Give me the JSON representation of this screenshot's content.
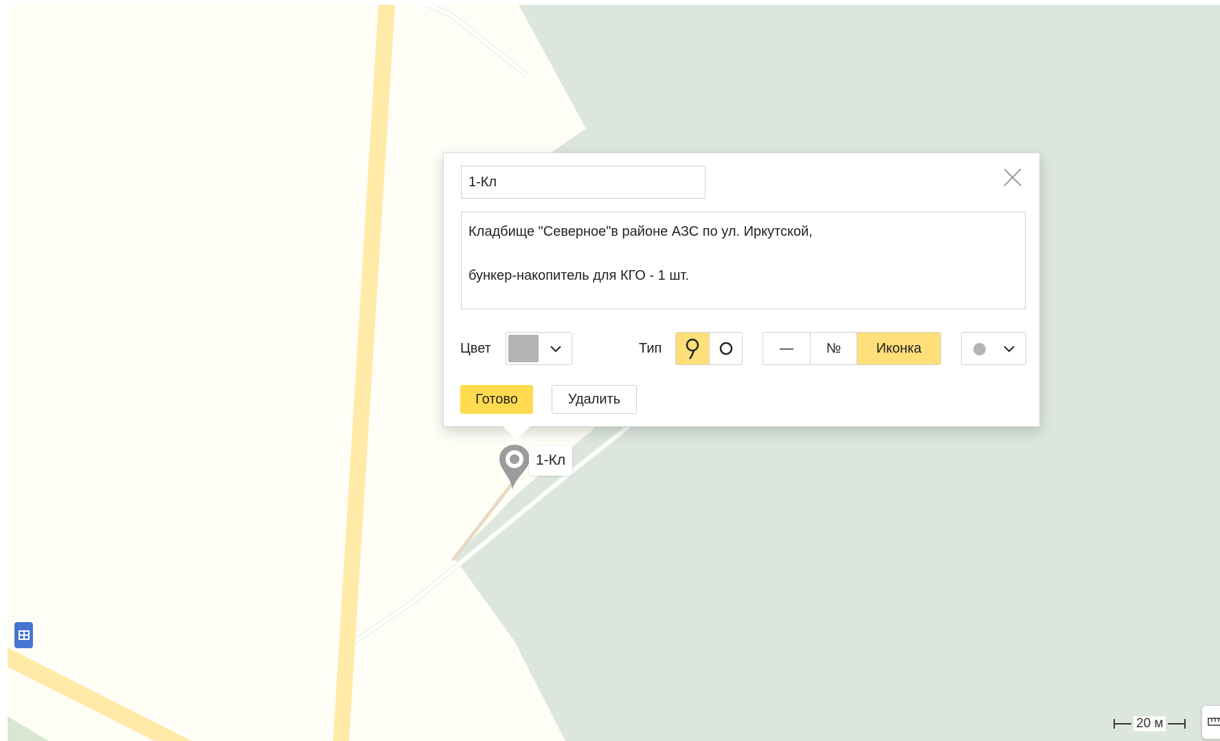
{
  "balloon": {
    "name_value": "1-Кл",
    "description_value": "Кладбище \"Северное\"в районе АЗС по ул. Иркутской,\n\nбункер-накопитель для КГО - 1 шт.",
    "color_label": "Цвет",
    "selected_color": "#b3b3b3",
    "type_label": "Тип",
    "type_options": [
      {
        "icon": "pin-icon",
        "active": true
      },
      {
        "icon": "circle-icon",
        "active": false
      }
    ],
    "content_options": [
      "—",
      "№",
      "Иконка"
    ],
    "content_active": "Иконка",
    "icon_select_value": "dot-icon",
    "done_label": "Готово",
    "delete_label": "Удалить"
  },
  "placemark": {
    "label": "1-Кл",
    "color": "#9c9c9c"
  },
  "scale": {
    "text": "20 м"
  },
  "colors": {
    "map_land": "#fefdf6",
    "map_forest": "#dce6dc",
    "road_major": "#ffeaa8",
    "accent_yellow": "#ffdb4d",
    "active_segment": "#ffdf79",
    "poi_blue": "#4575d1"
  }
}
